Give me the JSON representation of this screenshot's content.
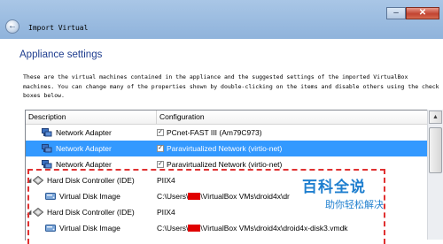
{
  "window": {
    "title": "Import Virtual",
    "back_glyph": "←",
    "minimize_glyph": "–",
    "close_glyph": "✕"
  },
  "page": {
    "heading": "Appliance settings",
    "description": "These are the virtual machines contained in the appliance and the suggested settings of the imported VirtualBox machines. You can change many of the properties shown by double-clicking on the items and disable others using the check boxes below."
  },
  "table": {
    "columns": [
      "Description",
      "Configuration"
    ],
    "rows": [
      {
        "description": "Network Adapter",
        "config": "PCnet-FAST III (Am79C973)",
        "checkbox": true,
        "selected": false,
        "icon": "network-adapter-icon"
      },
      {
        "description": "Network Adapter",
        "config": "Paravirtualized Network (virtio-net)",
        "checkbox": true,
        "selected": true,
        "icon": "network-adapter-icon"
      },
      {
        "description": "Network Adapter",
        "config": "Paravirtualized Network (virtio-net)",
        "checkbox": true,
        "selected": false,
        "icon": "network-adapter-icon"
      },
      {
        "description": "Hard Disk Controller (IDE)",
        "config": "PIIX4",
        "checkbox": false,
        "selected": false,
        "icon": "hard-disk-controller-icon",
        "expander": "◢"
      },
      {
        "description": "Virtual Disk Image",
        "config_prefix": "C:\\Users\\",
        "config_suffix": "\\VirtualBox VMs\\droid4x\\dr",
        "checkbox": false,
        "selected": false,
        "icon": "virtual-disk-icon"
      },
      {
        "description": "Hard Disk Controller (IDE)",
        "config": "PIIX4",
        "checkbox": false,
        "selected": false,
        "icon": "hard-disk-controller-icon",
        "expander": "◢"
      },
      {
        "description": "Virtual Disk Image",
        "config_prefix": "C:\\Users\\",
        "config_suffix": "\\VirtualBox VMs\\droid4x\\droid4x-disk3.vmdk",
        "checkbox": false,
        "selected": false,
        "icon": "virtual-disk-icon"
      },
      {
        "description": "Virtual Disk Image",
        "config_prefix": "C:\\Users\\",
        "config_suffix": "\\VirtualBox VMs\\droid4x\\droid4x-disk2.vmdk",
        "checkbox": false,
        "selected": false,
        "icon": "virtual-disk-icon"
      }
    ]
  },
  "watermark": {
    "logo": "百科全说",
    "sub": "助你轻松解决"
  },
  "colors": {
    "heading": "#1e3d8f",
    "selection": "#3399ff",
    "annotation": "#e03131",
    "redaction": "#e00000"
  }
}
